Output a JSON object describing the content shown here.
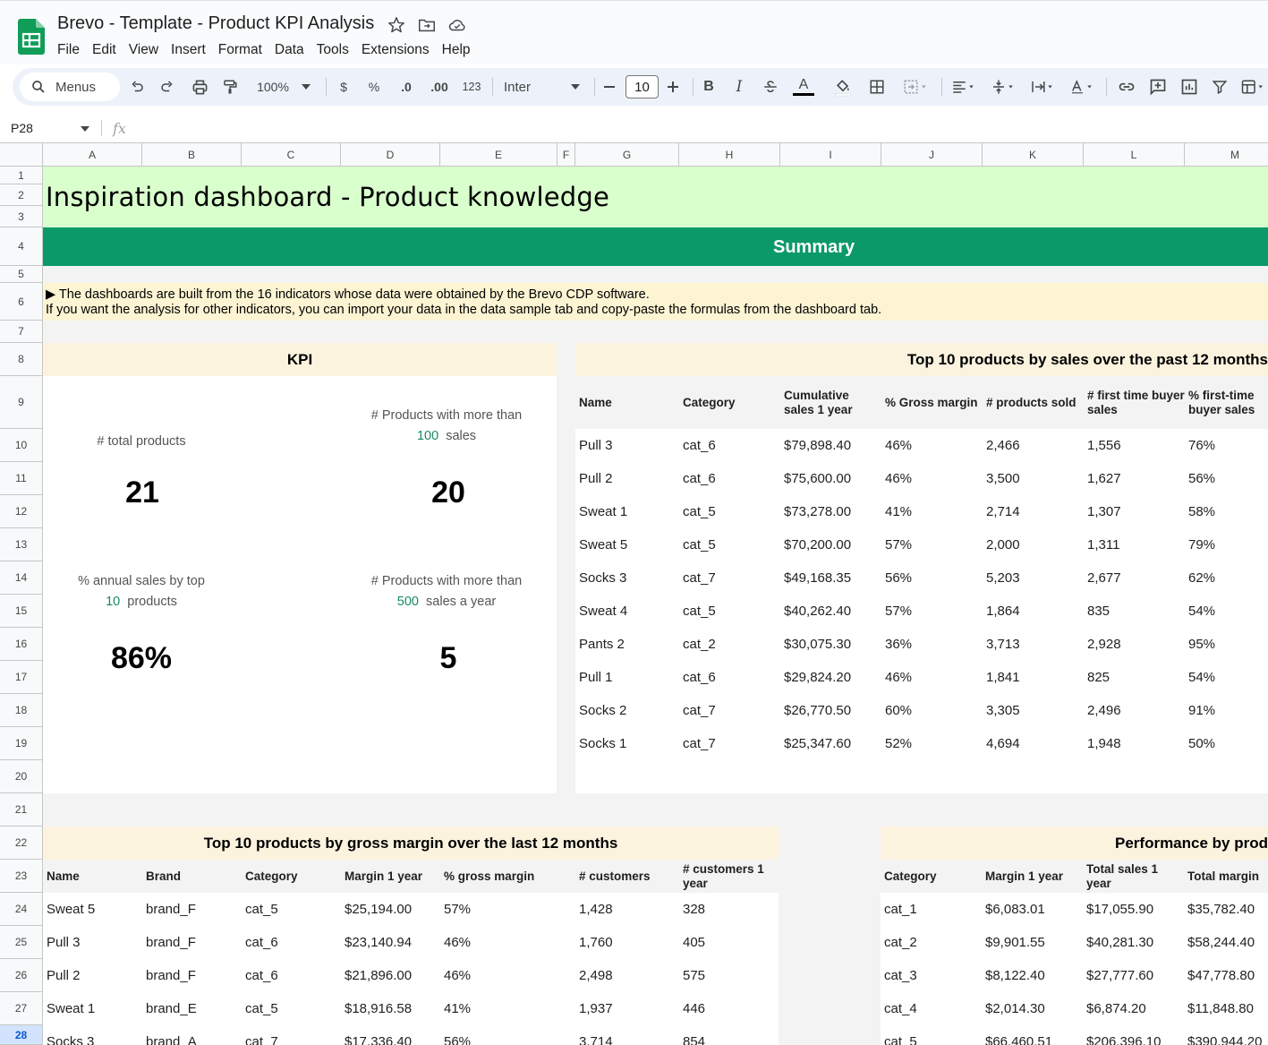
{
  "app": {
    "doc_title": "Brevo - Template - Product KPI Analysis",
    "menu": [
      "File",
      "Edit",
      "View",
      "Insert",
      "Format",
      "Data",
      "Tools",
      "Extensions",
      "Help"
    ]
  },
  "toolbar": {
    "search_label": "Menus",
    "zoom": "100%",
    "currency": "$",
    "percent": "%",
    "decrease_decimal": ".0",
    "increase_decimal": ".00",
    "number_format": "123",
    "font": "Inter",
    "font_size": "10",
    "bold": "B",
    "italic": "I",
    "text_color_letter": "A"
  },
  "formula_bar": {
    "cell_ref": "P28",
    "fx": "fx",
    "value": ""
  },
  "columns": [
    "A",
    "B",
    "C",
    "D",
    "E",
    "F",
    "G",
    "H",
    "I",
    "J",
    "K",
    "L",
    "M"
  ],
  "rows": [
    "1",
    "2",
    "3",
    "4",
    "5",
    "6",
    "7",
    "8",
    "9",
    "10",
    "11",
    "12",
    "13",
    "14",
    "15",
    "16",
    "17",
    "18",
    "19",
    "20",
    "21",
    "22",
    "23",
    "24",
    "25",
    "26",
    "27",
    "28"
  ],
  "active_row": "28",
  "dashboard": {
    "title": "Inspiration dashboard - Product knowledge",
    "summary": "Summary",
    "info_line_1": "▶ The dashboards are built from the 16 indicators whose data were obtained by the Brevo CDP software.",
    "info_line_2": "If you want the analysis for other indicators, you can import your data in the data sample tab and copy-paste the formulas from the dashboard tab."
  },
  "kpi": {
    "title": "KPI",
    "total_products_label": "# total products",
    "total_products_value": "21",
    "more_than_label_a": "# Products with more than",
    "more_than_threshold": "100",
    "more_than_suffix": "sales",
    "more_than_value": "20",
    "annual_share_label_a": "% annual sales by top",
    "annual_share_top": "10",
    "annual_share_suffix": "products",
    "annual_share_value": "86%",
    "year_label_a": "# Products with more than",
    "year_threshold": "500",
    "year_suffix": "sales a year",
    "year_value": "5"
  },
  "top_sales": {
    "title": "Top 10 products by sales over the past 12 months",
    "headers": [
      "Name",
      "Category",
      "Cumulative sales 1 year",
      "% Gross margin",
      "# products sold",
      "# first time buyer sales",
      "% first-time buyer sales"
    ],
    "rows": [
      [
        "Pull 3",
        "cat_6",
        "$79,898.40",
        "46%",
        "2,466",
        "1,556",
        "76%"
      ],
      [
        "Pull 2",
        "cat_6",
        "$75,600.00",
        "46%",
        "3,500",
        "1,627",
        "56%"
      ],
      [
        "Sweat 1",
        "cat_5",
        "$73,278.00",
        "41%",
        "2,714",
        "1,307",
        "58%"
      ],
      [
        "Sweat 5",
        "cat_5",
        "$70,200.00",
        "57%",
        "2,000",
        "1,311",
        "79%"
      ],
      [
        "Socks 3",
        "cat_7",
        "$49,168.35",
        "56%",
        "5,203",
        "2,677",
        "62%"
      ],
      [
        "Sweat 4",
        "cat_5",
        "$40,262.40",
        "57%",
        "1,864",
        "835",
        "54%"
      ],
      [
        "Pants 2",
        "cat_2",
        "$30,075.30",
        "36%",
        "3,713",
        "2,928",
        "95%"
      ],
      [
        "Pull 1",
        "cat_6",
        "$29,824.20",
        "46%",
        "1,841",
        "825",
        "54%"
      ],
      [
        "Socks 2",
        "cat_7",
        "$26,770.50",
        "60%",
        "3,305",
        "2,496",
        "91%"
      ],
      [
        "Socks 1",
        "cat_7",
        "$25,347.60",
        "52%",
        "4,694",
        "1,948",
        "50%"
      ]
    ]
  },
  "top_margin": {
    "title": "Top 10 products by gross margin over the last 12 months",
    "headers": [
      "Name",
      "Brand",
      "Category",
      "Margin 1 year",
      "% gross margin",
      "# customers",
      "# customers 1 year"
    ],
    "rows": [
      [
        "Sweat 5",
        "brand_F",
        "cat_5",
        "$25,194.00",
        "57%",
        "1,428",
        "328"
      ],
      [
        "Pull 3",
        "brand_F",
        "cat_6",
        "$23,140.94",
        "46%",
        "1,760",
        "405"
      ],
      [
        "Pull 2",
        "brand_F",
        "cat_6",
        "$21,896.00",
        "46%",
        "2,498",
        "575"
      ],
      [
        "Sweat 1",
        "brand_E",
        "cat_5",
        "$18,916.58",
        "41%",
        "1,937",
        "446"
      ],
      [
        "Socks 3",
        "brand_A",
        "cat_7",
        "$17,336.40",
        "56%",
        "3,714",
        "854"
      ]
    ]
  },
  "performance": {
    "title": "Performance by prod",
    "headers": [
      "Category",
      "Margin 1 year",
      "Total sales 1 year",
      "Total margin"
    ],
    "rows": [
      [
        "cat_1",
        "$6,083.01",
        "$17,055.90",
        "$35,782.40"
      ],
      [
        "cat_2",
        "$9,901.55",
        "$40,281.30",
        "$58,244.40"
      ],
      [
        "cat_3",
        "$8,122.40",
        "$27,777.60",
        "$47,778.80"
      ],
      [
        "cat_4",
        "$2,014.30",
        "$6,874.20",
        "$11,848.80"
      ],
      [
        "cat_5",
        "$66,460.51",
        "$206,396.10",
        "$390,944.20"
      ]
    ]
  },
  "colors": {
    "title_band": "#d9ffcd",
    "summary_band": "#0b9969",
    "info_band": "#fdf4d3",
    "panel_header": "#fcf3df",
    "accent_green": "#188a5f"
  }
}
